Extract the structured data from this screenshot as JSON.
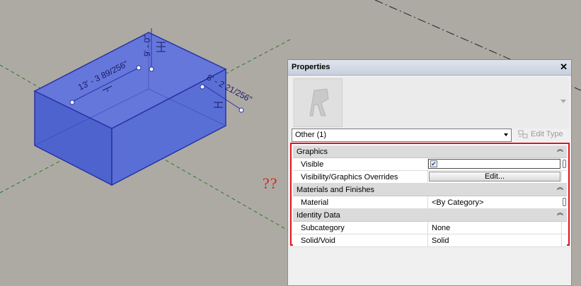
{
  "viewport": {
    "dimensions": {
      "length": "13' - 3 89/256\"",
      "height": "9' - 0\"",
      "width": "8' - 2 21/256\""
    }
  },
  "annotation": {
    "text": "??"
  },
  "properties_panel": {
    "title": "Properties",
    "close_icon": "close-icon",
    "type_selector": {
      "value": "Other (1)"
    },
    "edit_type_label": "Edit Type",
    "highlight_color": "#e0141f",
    "sections": [
      {
        "label": "Graphics",
        "rows": [
          {
            "name": "Visible",
            "value": "",
            "checked": true
          },
          {
            "name": "Visibility/Graphics Overrides",
            "value": "Edit..."
          }
        ]
      },
      {
        "label": "Materials and Finishes",
        "rows": [
          {
            "name": "Material",
            "value": "<By Category>"
          }
        ]
      },
      {
        "label": "Identity Data",
        "rows": [
          {
            "name": "Subcategory",
            "value": "None"
          },
          {
            "name": "Solid/Void",
            "value": "Solid"
          }
        ]
      }
    ]
  },
  "colors": {
    "background": "#adaaa3",
    "selection_fill": "#5a6fd6",
    "selection_edge": "#2833a5"
  }
}
